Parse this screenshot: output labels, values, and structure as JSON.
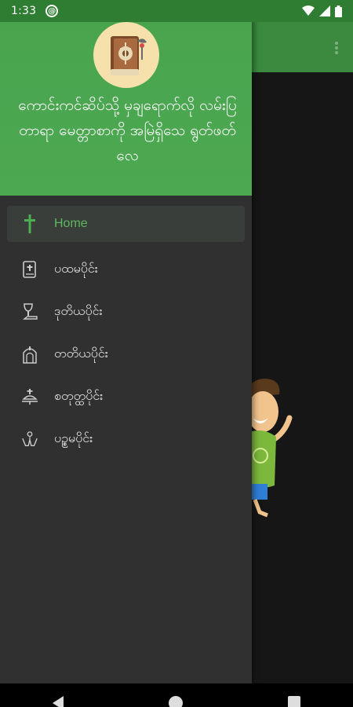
{
  "status_bar": {
    "time": "1:33",
    "notification_icon": "at-sign-icon",
    "icons": [
      "wifi-icon",
      "signal-icon",
      "battery-icon"
    ]
  },
  "drawer": {
    "header": {
      "logo_icon": "bible-book-icon",
      "title": "ကောင်းကင်ဆိပ်သို့ မှချရောက်လို လမ်းပြတာရာ မေတ္တာစာကို အမြဲရှိသေ ရွတ်ဖတ်လေ"
    },
    "items": [
      {
        "label": "Home",
        "icon": "cross-icon",
        "active": true
      },
      {
        "label": "ပထမပိုင်း",
        "icon": "bible-icon",
        "active": false
      },
      {
        "label": "ဒုတိယပိုင်း",
        "icon": "chalice-icon",
        "active": false
      },
      {
        "label": "တတိယပိုင်း",
        "icon": "church-door-icon",
        "active": false
      },
      {
        "label": "စတုတ္ထပိုင်း",
        "icon": "altar-icon",
        "active": false
      },
      {
        "label": "ပဥ္စမပိုင်း",
        "icon": "praying-hands-icon",
        "active": false
      }
    ]
  },
  "colors": {
    "accent": "#4caf50",
    "drawer_bg": "#303030",
    "active_text": "#5cb860"
  },
  "navigation_bar": {
    "buttons": [
      "back-icon",
      "home-icon",
      "recent-apps-icon"
    ]
  }
}
